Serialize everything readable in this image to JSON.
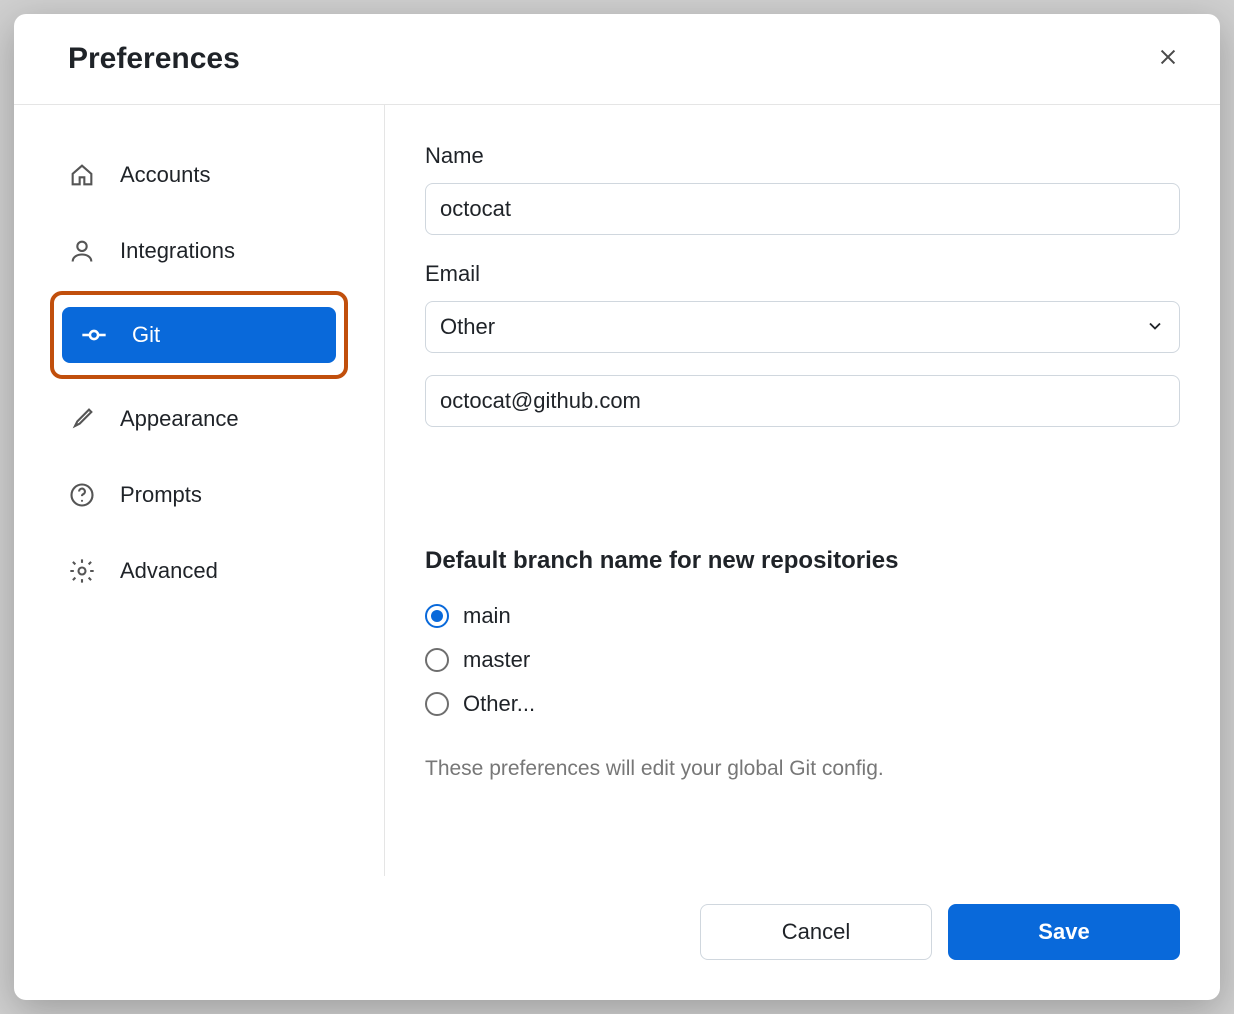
{
  "dialog": {
    "title": "Preferences"
  },
  "sidebar": {
    "items": [
      {
        "label": "Accounts"
      },
      {
        "label": "Integrations"
      },
      {
        "label": "Git"
      },
      {
        "label": "Appearance"
      },
      {
        "label": "Prompts"
      },
      {
        "label": "Advanced"
      }
    ]
  },
  "form": {
    "name_label": "Name",
    "name_value": "octocat",
    "email_label": "Email",
    "email_select": "Other",
    "email_value": "octocat@github.com"
  },
  "branch": {
    "heading": "Default branch name for new repositories",
    "options": [
      {
        "label": "main",
        "checked": true
      },
      {
        "label": "master",
        "checked": false
      },
      {
        "label": "Other...",
        "checked": false
      }
    ],
    "hint": "These preferences will edit your global Git config."
  },
  "footer": {
    "cancel": "Cancel",
    "save": "Save"
  }
}
